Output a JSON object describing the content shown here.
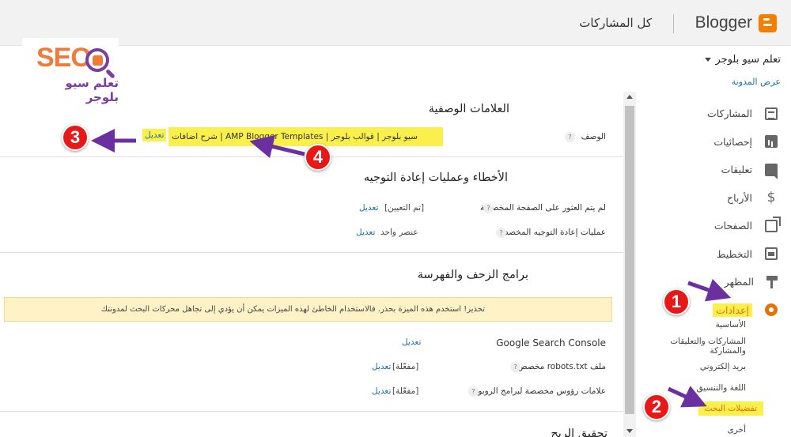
{
  "header": {
    "brand": "Blogger",
    "page_title": "كل المشاركات"
  },
  "logo": {
    "text": "SEO",
    "subtitle": "تعلم سيو بلوجر"
  },
  "sidebar": {
    "blog_name": "تعلم سيو بلوجر",
    "view_blog": "عرض المدونة",
    "items": [
      {
        "label": "المشاركات",
        "icon": "posts-icon"
      },
      {
        "label": "إحصائيات",
        "icon": "stats-icon"
      },
      {
        "label": "تعليقات",
        "icon": "comments-icon"
      },
      {
        "label": "الأرباح",
        "icon": "earnings-icon"
      },
      {
        "label": "الصفحات",
        "icon": "pages-icon"
      },
      {
        "label": "التخطيط",
        "icon": "layout-icon"
      },
      {
        "label": "المظهر",
        "icon": "theme-icon"
      },
      {
        "label": "إعدادات",
        "icon": "settings-icon"
      }
    ],
    "sub_items": [
      {
        "label": "الأساسية"
      },
      {
        "label": "المشاركات والتعليقات والمشاركة"
      },
      {
        "label": "بريد إلكتروني"
      },
      {
        "label": "اللغة والتنسيق"
      },
      {
        "label": "تفضيلات البحث"
      },
      {
        "label": "أخرى"
      }
    ]
  },
  "main": {
    "meta_tags": {
      "title": "العلامات الوصفية",
      "description_label": "الوصف",
      "description_value": "سيو بلوجر | قوالب بلوجر | AMP Blogger Templates | شرح اضافات بلوجر",
      "edit": "تعديل"
    },
    "errors": {
      "title": "الأخطاء وعمليات إعادة التوجيه",
      "rows": [
        {
          "label": "لم يتم العثور على الصفحة المخصصة",
          "value": "[تم التعيين]",
          "edit": "تعديل"
        },
        {
          "label": "عمليات إعادة التوجيه المخصصة",
          "value": "عنصر واحد",
          "edit": "تعديل"
        }
      ]
    },
    "crawlers": {
      "title": "برامج الزحف والفهرسة",
      "warning": "تحذير! استخدم هذه الميزة بحذر. فالاستخدام الخاطئ لهذه الميزات يمكن أن يؤدي إلى تجاهل محركات البحث لمدونتك",
      "rows": [
        {
          "label": "Google Search Console",
          "value": "",
          "edit": "تعديل"
        },
        {
          "label": "ملف robots.txt مخصص",
          "value": "[مفعّلة]",
          "edit": "تعديل"
        },
        {
          "label": "علامات رؤوس مخصصة لبرامج الروبوت",
          "value": "[مفعّلة]",
          "edit": "تعديل"
        }
      ]
    },
    "next_section_title": "تحقيق الربح"
  },
  "annotations": {
    "badges": [
      "1",
      "2",
      "3",
      "4"
    ],
    "badge_color": "#e81818",
    "arrow_color": "#6b2fa0",
    "highlight_color": "#fbf04b"
  }
}
